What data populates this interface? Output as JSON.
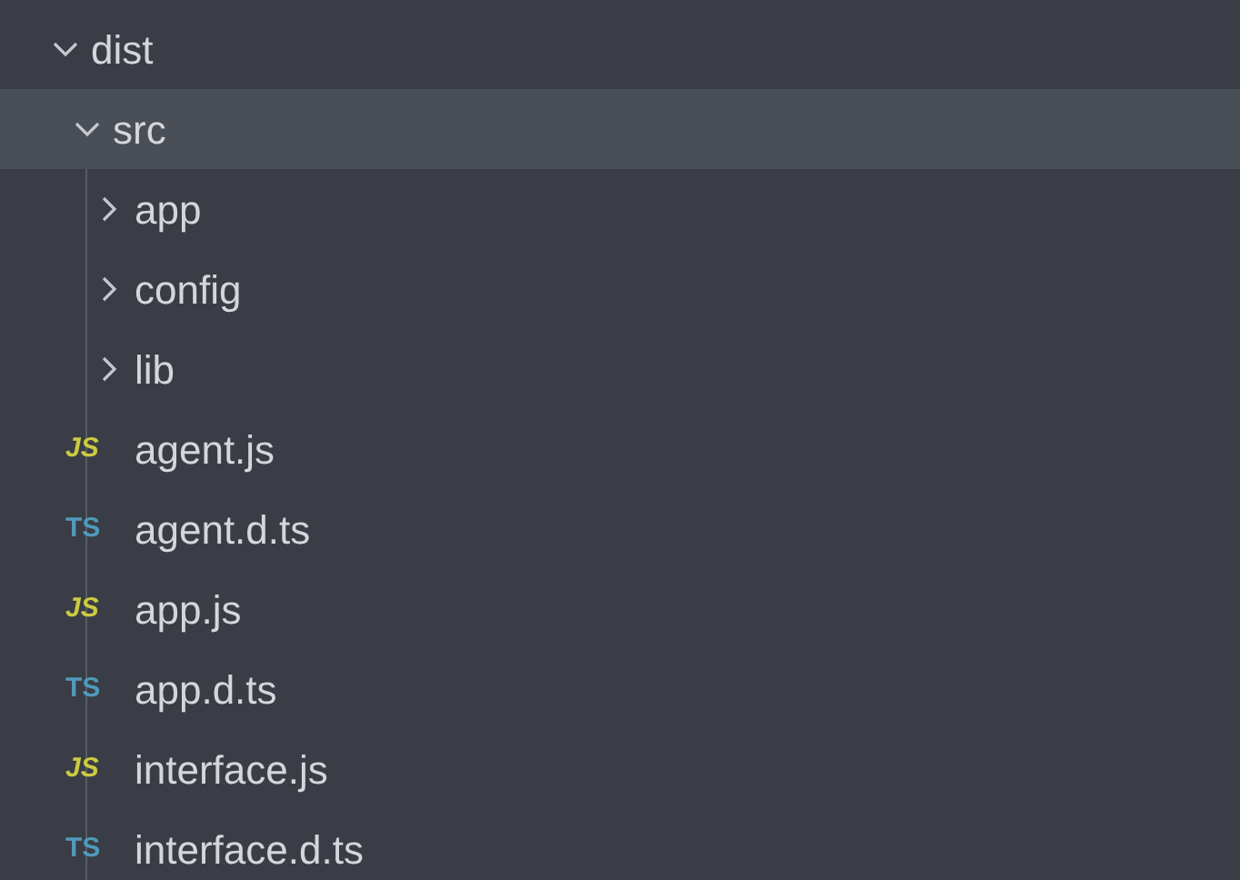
{
  "explorer": {
    "tree": [
      {
        "kind": "folder",
        "label": "dist",
        "expanded": true,
        "selected": false,
        "children": [
          {
            "kind": "folder",
            "label": "src",
            "expanded": true,
            "selected": true,
            "children": [
              {
                "kind": "folder",
                "label": "app",
                "expanded": false,
                "selected": false
              },
              {
                "kind": "folder",
                "label": "config",
                "expanded": false,
                "selected": false
              },
              {
                "kind": "folder",
                "label": "lib",
                "expanded": false,
                "selected": false
              },
              {
                "kind": "js",
                "icon": "JS",
                "label": "agent.js",
                "selected": false
              },
              {
                "kind": "ts",
                "icon": "TS",
                "label": "agent.d.ts",
                "selected": false
              },
              {
                "kind": "js",
                "icon": "JS",
                "label": "app.js",
                "selected": false
              },
              {
                "kind": "ts",
                "icon": "TS",
                "label": "app.d.ts",
                "selected": false
              },
              {
                "kind": "js",
                "icon": "JS",
                "label": "interface.js",
                "selected": false
              },
              {
                "kind": "ts",
                "icon": "TS",
                "label": "interface.d.ts",
                "selected": false
              }
            ]
          }
        ]
      }
    ]
  }
}
